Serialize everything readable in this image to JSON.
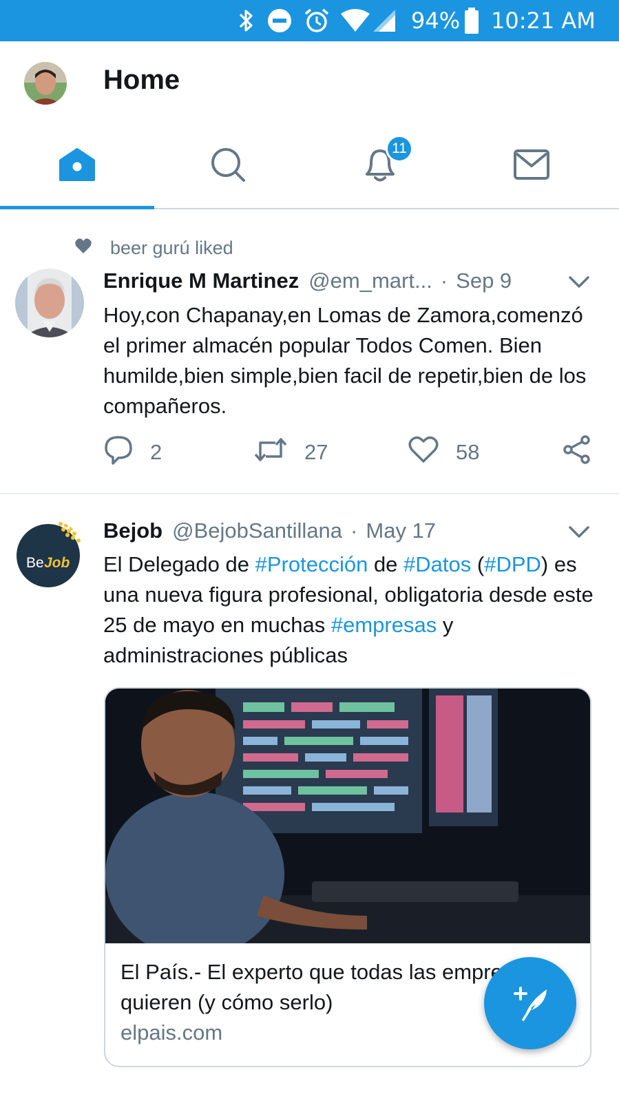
{
  "status_bar": {
    "battery": "94%",
    "time": "10:21 AM",
    "icons": [
      "bluetooth-icon",
      "do-not-disturb-icon",
      "alarm-icon",
      "wifi-icon",
      "cellular-signal-icon",
      "battery-icon"
    ]
  },
  "header": {
    "title": "Home"
  },
  "tabs": [
    {
      "name": "home",
      "icon": "home-icon",
      "active": true
    },
    {
      "name": "search",
      "icon": "search-icon",
      "active": false
    },
    {
      "name": "notifications",
      "icon": "bell-icon",
      "active": false,
      "badge": "11"
    },
    {
      "name": "messages",
      "icon": "mail-icon",
      "active": false
    }
  ],
  "feed": {
    "social_context": "beer gurú liked",
    "tweets": [
      {
        "name": "Enrique M Martinez",
        "handle": "@em_mart...",
        "separator": "·",
        "time": "Sep 9",
        "text": "Hoy,con Chapanay,en Lomas de Zamora,comenzó el primer almacén popular Todos Comen. Bien humilde,bien simple,bien facil de repetir,bien de los compañeros.",
        "replies": "2",
        "retweets": "27",
        "likes": "58"
      },
      {
        "name": "Bejob",
        "handle": "@BejobSantillana",
        "separator": "·",
        "time": "May 17",
        "avatar_text": {
          "be": "Be",
          "job": "Job"
        },
        "text_parts": {
          "t1": "El Delegado de ",
          "h1": "#Protección",
          "t2": " de ",
          "h2": "#Datos",
          "t3": " (",
          "h3": "#DPD",
          "t4": ") es una nueva figura profesional, obligatoria desde este 25 de mayo en muchas ",
          "h4": "#empresas",
          "t5": " y administraciones públicas"
        },
        "card": {
          "title": "El País.- El experto que todas las empresas quieren (y cómo serlo)",
          "domain": "elpais.com"
        }
      }
    ]
  },
  "colors": {
    "accent": "#1b95e0",
    "text": "#14171a",
    "secondary": "#657786",
    "border": "#ccd6dd"
  }
}
